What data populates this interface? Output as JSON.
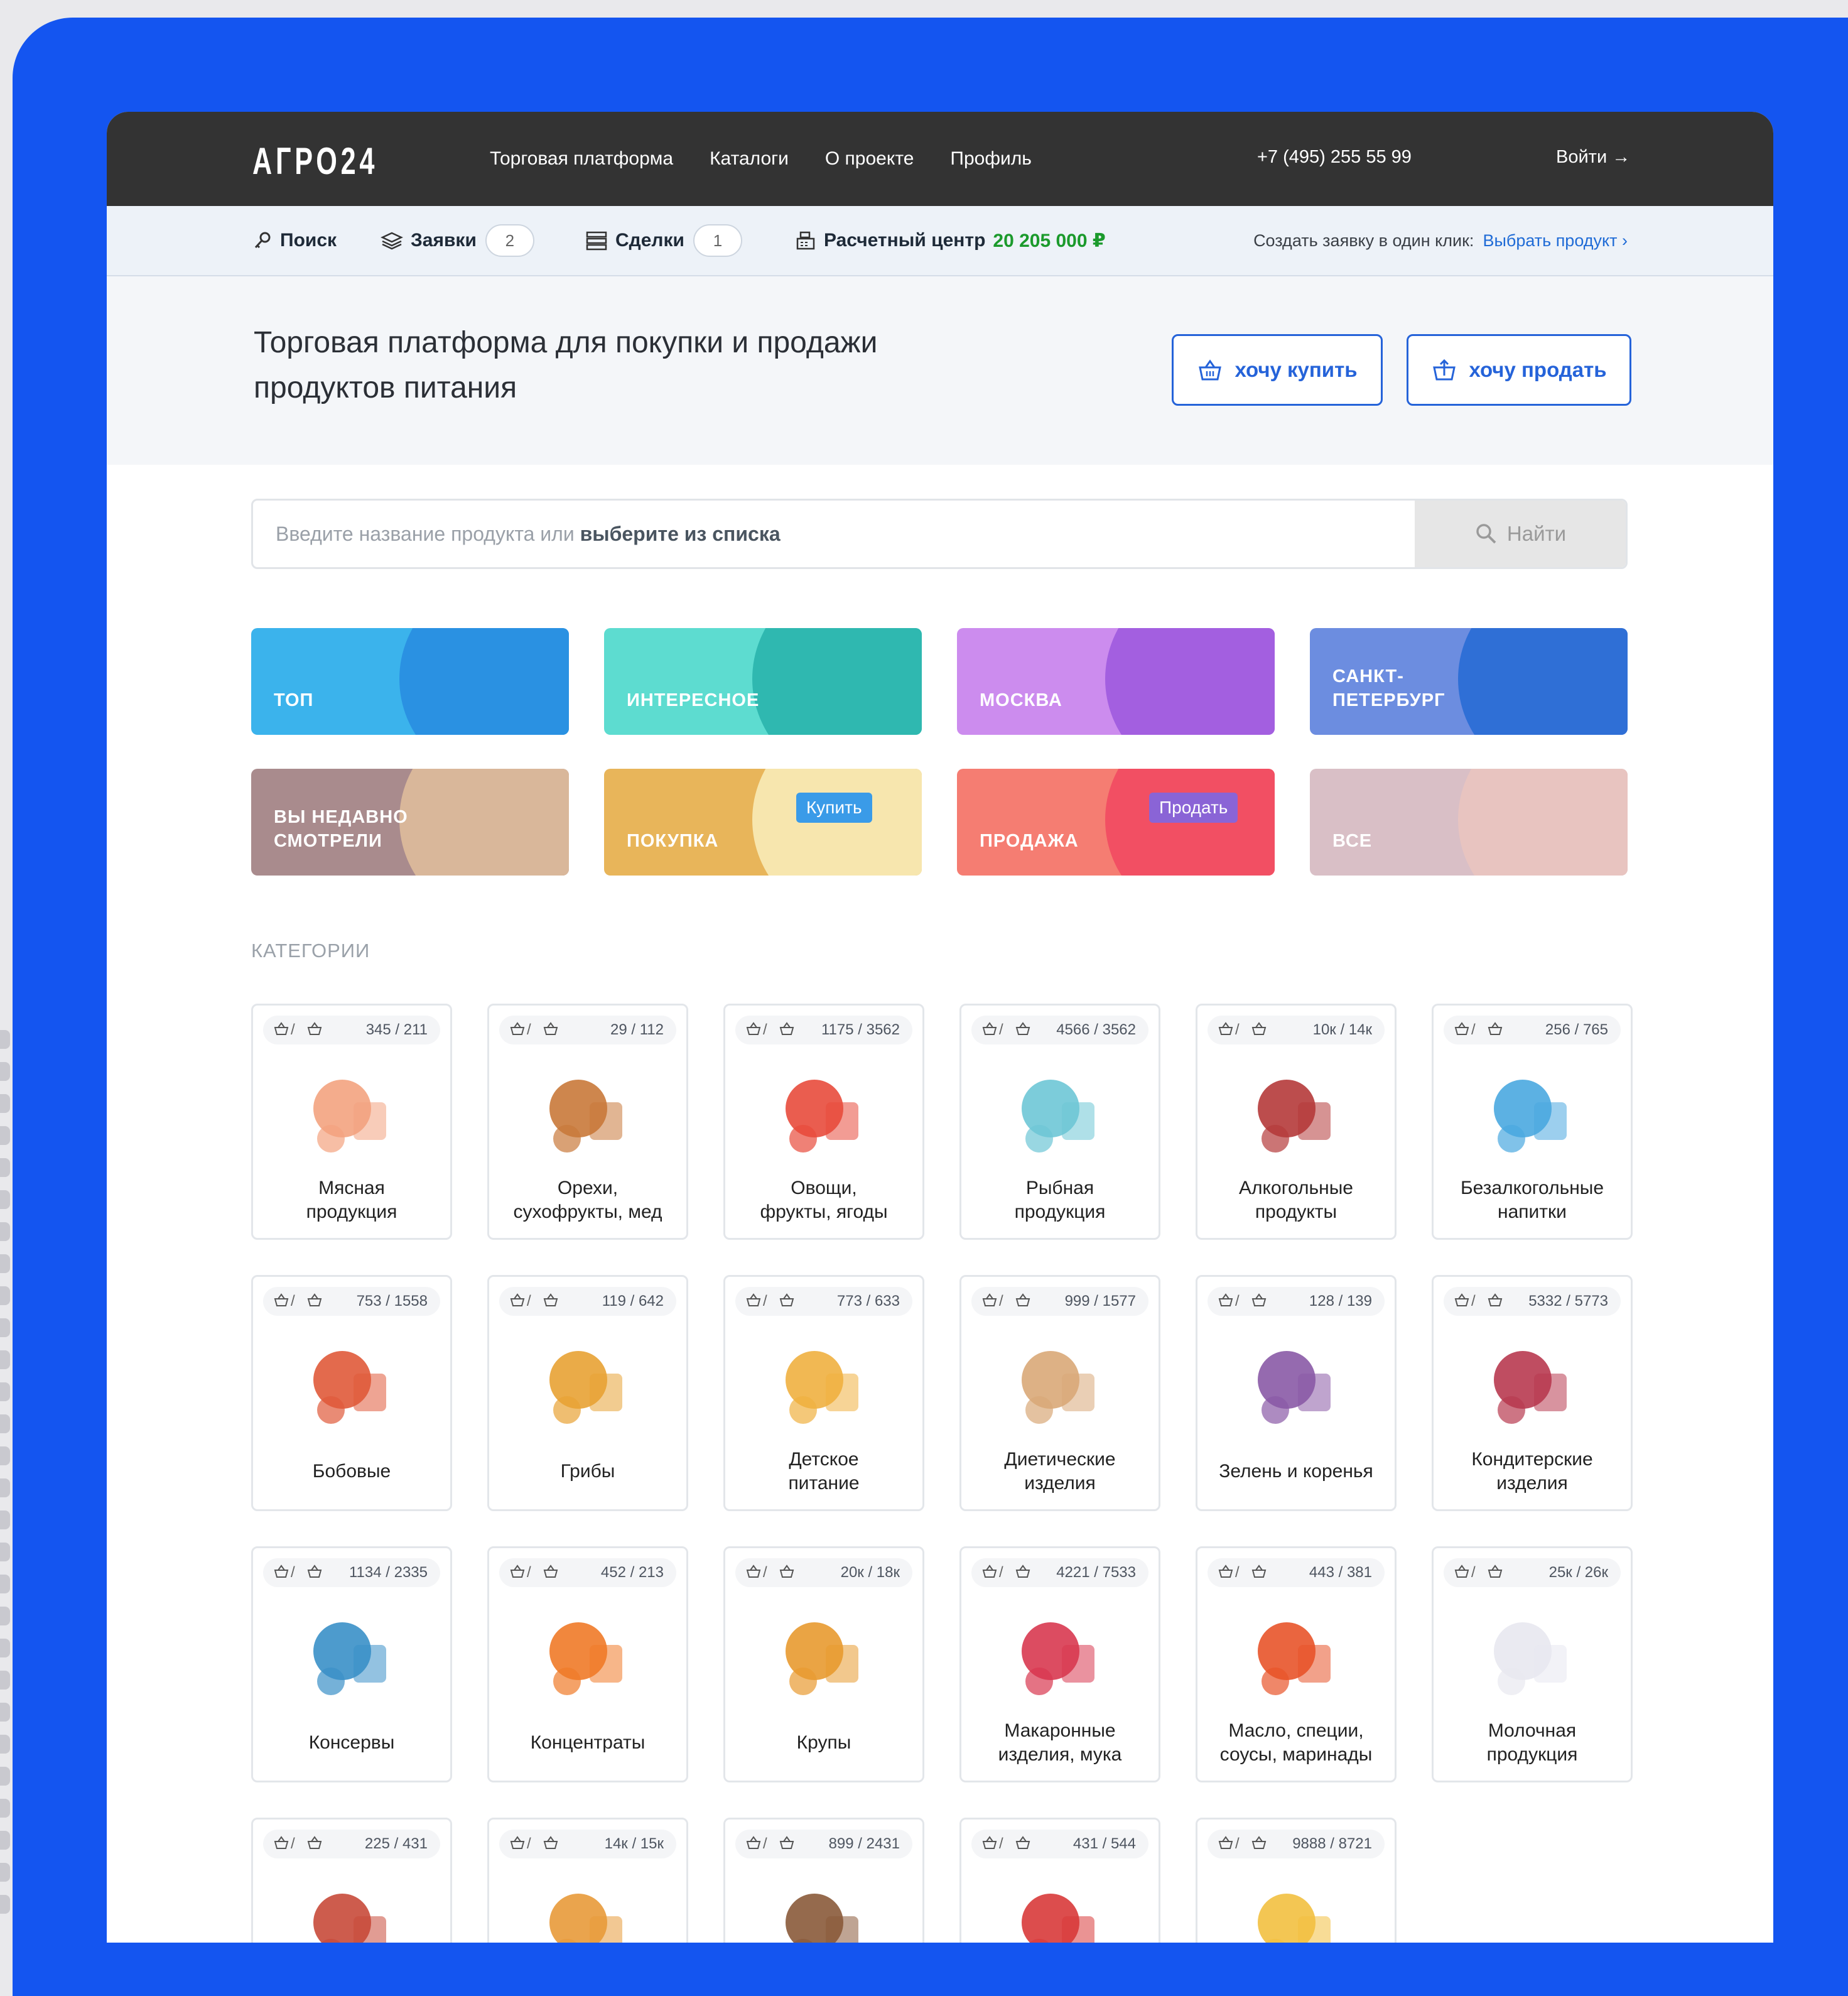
{
  "header": {
    "logo": "АГРО24",
    "nav": [
      "Торговая платформа",
      "Каталоги",
      "О проекте",
      "Профиль"
    ],
    "phone": "+7 (495) 255 55 99",
    "login": "Войти →"
  },
  "subbar": {
    "search": "Поиск",
    "orders": "Заявки",
    "orders_count": "2",
    "deals": "Сделки",
    "deals_count": "1",
    "settlement": "Расчетный центр",
    "balance": "20 205 000 ₽",
    "quick_label": "Создать заявку в один клик:",
    "quick_link": "Выбрать продукт"
  },
  "hero": {
    "title": "Торговая платформа для покупки и продажи продуктов питания",
    "buy": "хочу купить",
    "sell": "хочу продать"
  },
  "search": {
    "placeholder": "Введите название продукта или",
    "placeholder_bold": "выберите из списка",
    "button": "Найти"
  },
  "tiles": [
    {
      "label": "ТОП",
      "bg": "#3bb3ec",
      "blob": "#2a91e2"
    },
    {
      "label": "ИНТЕРЕСНОЕ",
      "bg": "#5ddcd0",
      "blob": "#2fb8b0"
    },
    {
      "label": "МОСКВА",
      "bg": "#cc8cee",
      "blob": "#a35fe0"
    },
    {
      "label": "САНКТ-\nПЕТЕРБУРГ",
      "bg": "#6c8de0",
      "blob": "#2f6fd6"
    },
    {
      "label": "ВЫ НЕДАВНО\nСМОТРЕЛИ",
      "bg": "#a98b8d",
      "blob": "#d9b79a"
    },
    {
      "label": "ПОКУПКА",
      "bg": "#e8b55a",
      "blob": "#f7e6ae",
      "tag": "Купить",
      "tag_color": "#3a9be8"
    },
    {
      "label": "ПРОДАЖА",
      "bg": "#f57d72",
      "blob": "#f24f63",
      "tag": "Продать",
      "tag_color": "#8a64d6"
    },
    {
      "label": "ВСЕ",
      "bg": "#d9bfc6",
      "blob": "#e8c4c0"
    }
  ],
  "categories_title": "КАТЕГОРИИ",
  "categories": [
    {
      "count": "345 / 211",
      "name": "Мясная\nпродукция",
      "icon": "meat-icon"
    },
    {
      "count": "29 / 112",
      "name": "Орехи,\nсухофрукты, мед",
      "icon": "nuts-honey-icon"
    },
    {
      "count": "1175 / 3562",
      "name": "Овощи,\nфрукты, ягоды",
      "icon": "vegetables-icon"
    },
    {
      "count": "4566 / 3562",
      "name": "Рыбная\nпродукция",
      "icon": "fish-icon"
    },
    {
      "count": "10к / 14к",
      "name": "Алкогольные\nпродукты",
      "icon": "alcohol-icon"
    },
    {
      "count": "256 / 765",
      "name": "Безалкогольные\nнапитки",
      "icon": "soft-drinks-icon"
    },
    {
      "count": "753 / 1558",
      "name": "Бобовые",
      "icon": "beans-icon"
    },
    {
      "count": "119 / 642",
      "name": "Грибы",
      "icon": "mushrooms-icon"
    },
    {
      "count": "773 / 633",
      "name": "Детское\nпитание",
      "icon": "baby-food-icon"
    },
    {
      "count": "999 / 1577",
      "name": "Диетические\nизделия",
      "icon": "diet-icon"
    },
    {
      "count": "128 / 139",
      "name": "Зелень и коренья",
      "icon": "herbs-icon"
    },
    {
      "count": "5332 / 5773",
      "name": "Кондитерские\nизделия",
      "icon": "confectionery-icon"
    },
    {
      "count": "1134 / 2335",
      "name": "Консервы",
      "icon": "canned-icon"
    },
    {
      "count": "452 / 213",
      "name": "Концентраты",
      "icon": "concentrates-icon"
    },
    {
      "count": "20к / 18к",
      "name": "Крупы",
      "icon": "grains-icon"
    },
    {
      "count": "4221 / 7533",
      "name": "Макаронные\nизделия, мука",
      "icon": "pasta-icon"
    },
    {
      "count": "443 / 381",
      "name": "Масло, специи,\nсоусы, маринады",
      "icon": "oil-spices-icon"
    },
    {
      "count": "25к / 26к",
      "name": "Молочная\nпродукция",
      "icon": "dairy-icon"
    },
    {
      "count": "225 / 431",
      "name": "",
      "icon": "tobacco-icon"
    },
    {
      "count": "14к / 15к",
      "name": "",
      "icon": "bakery-icon"
    },
    {
      "count": "899 / 2431",
      "name": "",
      "icon": "coffee-tea-icon"
    },
    {
      "count": "431 / 544",
      "name": "",
      "icon": "fast-food-icon"
    },
    {
      "count": "9888 / 8721",
      "name": "",
      "icon": "eggs-icon"
    }
  ]
}
